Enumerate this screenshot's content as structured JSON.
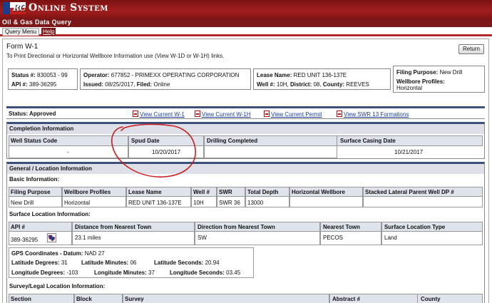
{
  "header": {
    "site_title": "Online System",
    "logo_text": "RC",
    "app_title": "Oil & Gas Data Query"
  },
  "menu": {
    "query_menu": "Query Menu",
    "help": "Help"
  },
  "form": {
    "title": "Form W-1",
    "subtitle": "To Print Directional or Horizontal Wellbore Information use (View W-1D or W-1H) links.",
    "return_button": "Return"
  },
  "summary": {
    "status_label": "Status #:",
    "status_value": "830053 - 99",
    "api_label": "API #:",
    "api_value": "389-36295",
    "operator_label": "Operator:",
    "operator_value": "677852 - PRIMEXX OPERATING CORPORATION",
    "issued_label": "Issued:",
    "issued_value": "08/25/2017,",
    "filed_label": "Filed:",
    "filed_value": "Online",
    "lease_label": "Lease Name:",
    "lease_value": "RED UNIT 136-137E",
    "well_label": "Well #:",
    "well_value": "10H,",
    "district_label": "District:",
    "district_value": "08,",
    "county_label": "County:",
    "county_value": "REEVES",
    "filing_label": "Filing Purpose:",
    "filing_value": "New Drill",
    "wellbore_label": "Wellbore Profiles:",
    "wellbore_value": "Horizontal"
  },
  "status_bar": {
    "status_text": "Status: Approved",
    "links": [
      "View Current W-1",
      "View Current W-1H",
      "View Current Permit",
      "View SWR 13 Formations"
    ]
  },
  "completion": {
    "heading": "Completion Information",
    "columns": [
      "Well Status Code",
      "Spud Date",
      "Drilling Completed",
      "Surface Casing Date"
    ],
    "values": [
      "-",
      "10/20/2017",
      "",
      "10/21/2017"
    ]
  },
  "general": {
    "heading": "General / Location Information",
    "basic_heading": "Basic Information:",
    "basic_columns": [
      "Filing Purpose",
      "Wellbore Profiles",
      "Lease Name",
      "Well #",
      "SWR",
      "Total Depth",
      "Horizontal Wellbore",
      "Stacked Lateral Parent Well DP #"
    ],
    "basic_values": [
      "New Drill",
      "Horizontal",
      "RED UNIT 136-137E",
      "10H",
      "SWR 36",
      "13000",
      "",
      ""
    ],
    "surface_heading": "Surface Location Information:",
    "surface_columns": [
      "API #",
      "Distance from Nearest Town",
      "Direction from Nearest Town",
      "Nearest Town",
      "Surface Location Type"
    ],
    "surface_values": [
      "389-36295",
      "23.1 miles",
      "SW",
      "PECOS",
      "Land"
    ],
    "gps": {
      "label": "GPS Coordinates - Datum:",
      "datum": "NAD 27",
      "lat_deg_label": "Latitude Degrees:",
      "lat_deg": "31",
      "lat_min_label": "Latitude Minutes:",
      "lat_min": "06",
      "lat_sec_label": "Latitude Seconds:",
      "lat_sec": "20.94",
      "lon_deg_label": "Longitude Degrees:",
      "lon_deg": "-103",
      "lon_min_label": "Longitude Minutes:",
      "lon_min": "37",
      "lon_sec_label": "Longitude Seconds:",
      "lon_sec": "03.45"
    },
    "survey_heading": "Survey/Legal Location Information:",
    "survey_columns": [
      "Section",
      "Block",
      "Survey",
      "Abstract #",
      "County"
    ]
  },
  "colors": {
    "banner": "#8b1515",
    "section_rule": "#3c5079",
    "annotation": "#c81e1e"
  }
}
